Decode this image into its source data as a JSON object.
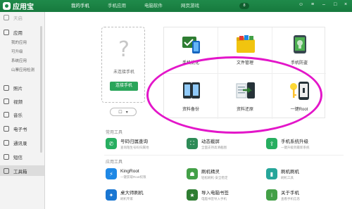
{
  "app": {
    "name": "应用宝"
  },
  "topbar": {
    "tabs": [
      "我的手机",
      "手机应用",
      "电脑软件",
      "网页游戏"
    ],
    "badge": "8"
  },
  "sidebar": {
    "device": "天启",
    "groups": [
      {
        "label": "应用",
        "subs": [
          "我的应用",
          "可升级",
          "系统应用",
          "山寨应用检测"
        ]
      },
      {
        "label": "照片"
      },
      {
        "label": "视频"
      },
      {
        "label": "音乐"
      },
      {
        "label": "电子书"
      },
      {
        "label": "通讯录"
      },
      {
        "label": "短信"
      },
      {
        "label": "工具箱"
      }
    ]
  },
  "connect": {
    "status": "未连接手机",
    "button": "连接手机"
  },
  "tools": [
    {
      "label": "手机优化"
    },
    {
      "label": "文件管理"
    },
    {
      "label": "手机防盗"
    },
    {
      "label": "资料备份"
    },
    {
      "label": "资料还原"
    },
    {
      "label": "一键Root"
    }
  ],
  "sections": {
    "common": "常用工具",
    "apps": "应用工具"
  },
  "common_tools": [
    {
      "title": "号码归属查询",
      "desc": "查询陌生号码归属地"
    },
    {
      "title": "动态截屏",
      "desc": "全面支持高清截图"
    },
    {
      "title": "手机系统升级",
      "desc": "一键升级到最新系统"
    }
  ],
  "app_tools": [
    {
      "title": "KingRoot",
      "desc": "一键获取Root权限"
    },
    {
      "title": "刷机精灵",
      "desc": "轻松刷机·安全稳定"
    },
    {
      "title": "刷机刷机",
      "desc": "刷机工具"
    },
    {
      "title": "桌大师刷机",
      "desc": "刷机专家"
    },
    {
      "title": "导入电脑书签",
      "desc": "电脑书签导入手机"
    },
    {
      "title": "关于手机",
      "desc": "查看手机信息"
    }
  ],
  "colors": {
    "brand": "#1f8a4a",
    "accent": "#2aa55a",
    "annotation": "#e316c9"
  }
}
